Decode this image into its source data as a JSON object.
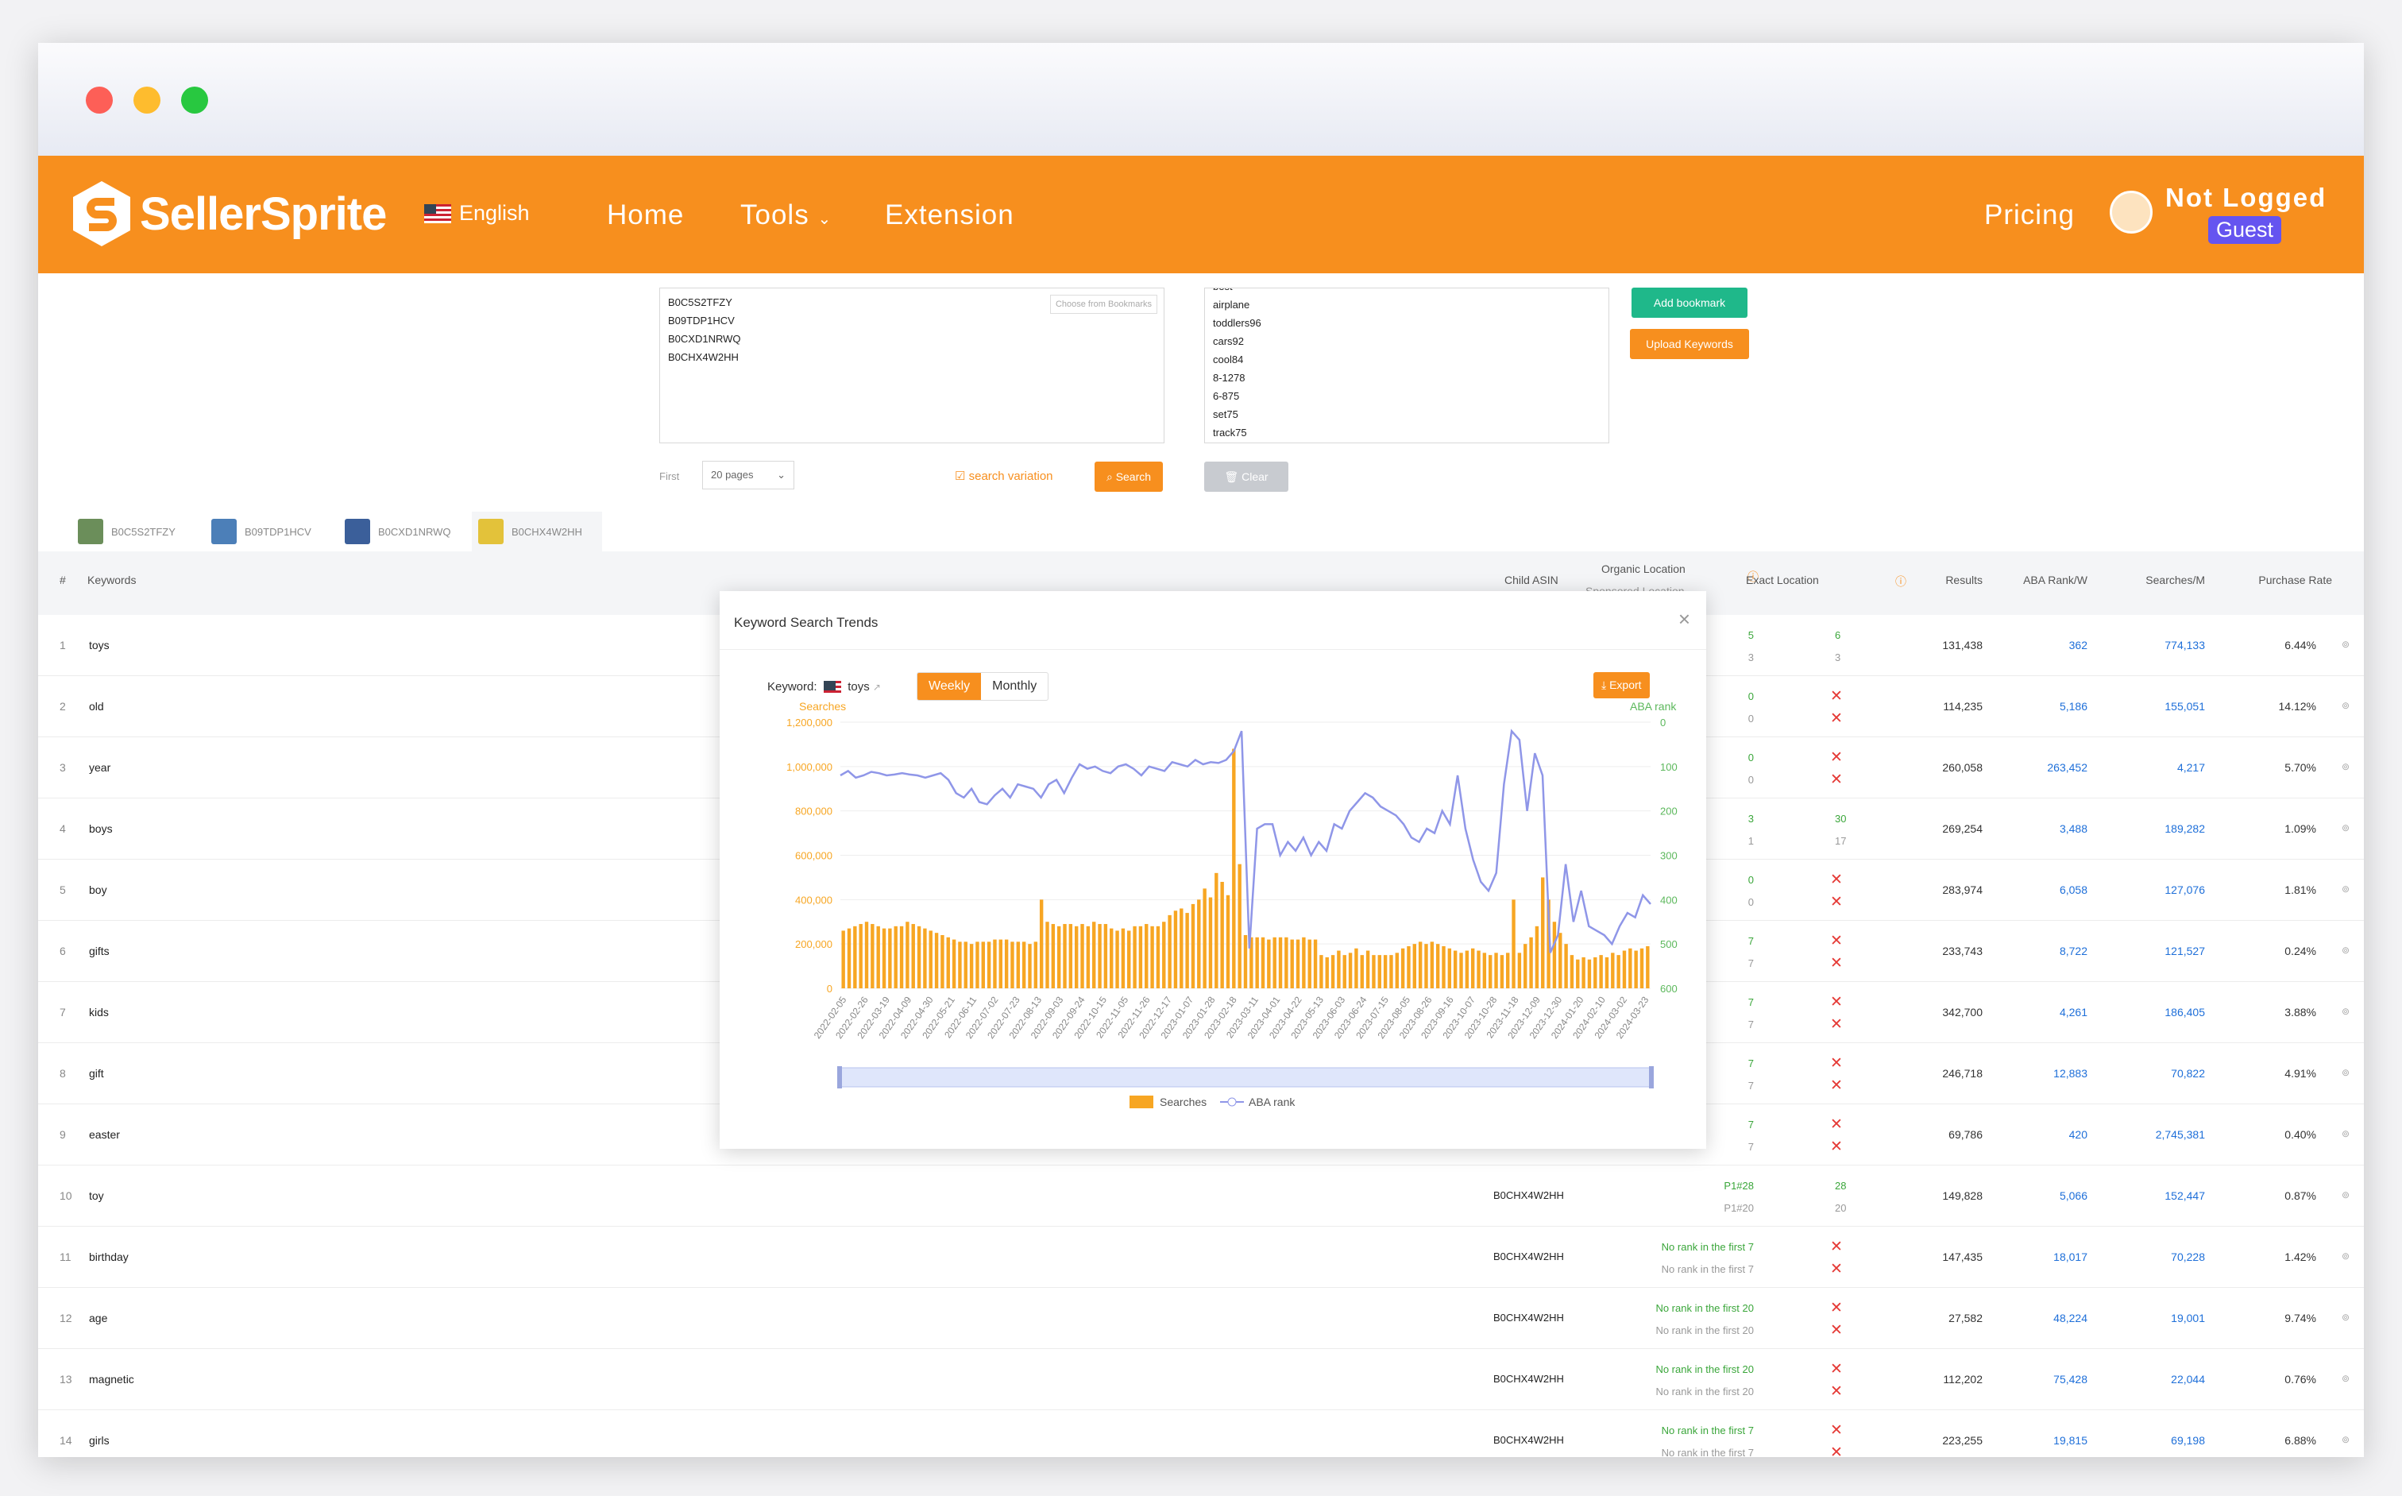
{
  "nav": {
    "logo": "SellerSprite",
    "lang": "English",
    "home": "Home",
    "tools": "Tools",
    "extension": "Extension",
    "pricing": "Pricing",
    "not_logged": "Not Logged",
    "guest": "Guest"
  },
  "form": {
    "asins": [
      "B0C5S2TFZY",
      "B09TDP1HCV",
      "B0CXD1NRWQ",
      "B0CHX4W2HH"
    ],
    "bookmark_placeholder": "Choose from Bookmarks",
    "keywords": [
      "best",
      "airplane",
      "toddlers96",
      "cars92",
      "cool84",
      "8-1278",
      "6-875",
      "set75",
      "track75"
    ],
    "add_bookmark": "Add bookmark",
    "upload_keywords": "Upload Keywords",
    "first_label": "First",
    "pages": "20 pages",
    "search_variation": "search variation",
    "search": "Search",
    "clear": "Clear"
  },
  "tabs": [
    "B0C5S2TFZY",
    "B09TDP1HCV",
    "B0CXD1NRWQ",
    "B0CHX4W2HH"
  ],
  "table": {
    "headers": {
      "num": "#",
      "keywords": "Keywords",
      "child_asin": "Child ASIN",
      "organic": "Organic Location",
      "sponsored": "Sponsored Location",
      "exact": "Exact Location",
      "results": "Results",
      "aba": "ABA Rank/W",
      "searches": "Searches/M",
      "purchase": "Purchase Rate"
    },
    "rows": [
      {
        "n": "1",
        "kw": "toys",
        "asin": "",
        "o1": "5",
        "o2": "3",
        "e1": "6",
        "e2": "3",
        "x": false,
        "res": "131,438",
        "aba": "362",
        "s": "774,133",
        "pr": "6.44%"
      },
      {
        "n": "2",
        "kw": "old",
        "asin": "",
        "o1": "0",
        "o2": "0",
        "e1": "",
        "e2": "",
        "x": true,
        "res": "114,235",
        "aba": "5,186",
        "s": "155,051",
        "pr": "14.12%"
      },
      {
        "n": "3",
        "kw": "year",
        "asin": "",
        "o1": "0",
        "o2": "0",
        "e1": "",
        "e2": "",
        "x": true,
        "res": "260,058",
        "aba": "263,452",
        "s": "4,217",
        "pr": "5.70%"
      },
      {
        "n": "4",
        "kw": "boys",
        "asin": "",
        "o1": "3",
        "o2": "1",
        "e1": "30",
        "e2": "17",
        "x": false,
        "res": "269,254",
        "aba": "3,488",
        "s": "189,282",
        "pr": "1.09%"
      },
      {
        "n": "5",
        "kw": "boy",
        "asin": "",
        "o1": "0",
        "o2": "0",
        "e1": "",
        "e2": "",
        "x": true,
        "res": "283,974",
        "aba": "6,058",
        "s": "127,076",
        "pr": "1.81%"
      },
      {
        "n": "6",
        "kw": "gifts",
        "asin": "",
        "o1": "7",
        "o2": "7",
        "e1": "",
        "e2": "",
        "x": true,
        "res": "233,743",
        "aba": "8,722",
        "s": "121,527",
        "pr": "0.24%"
      },
      {
        "n": "7",
        "kw": "kids",
        "asin": "",
        "o1": "7",
        "o2": "7",
        "e1": "",
        "e2": "",
        "x": true,
        "res": "342,700",
        "aba": "4,261",
        "s": "186,405",
        "pr": "3.88%"
      },
      {
        "n": "8",
        "kw": "gift",
        "asin": "",
        "o1": "7",
        "o2": "7",
        "e1": "",
        "e2": "",
        "x": true,
        "res": "246,718",
        "aba": "12,883",
        "s": "70,822",
        "pr": "4.91%"
      },
      {
        "n": "9",
        "kw": "easter",
        "asin": "",
        "o1": "7",
        "o2": "7",
        "e1": "",
        "e2": "",
        "x": true,
        "res": "69,786",
        "aba": "420",
        "s": "2,745,381",
        "pr": "0.40%"
      },
      {
        "n": "10",
        "kw": "toy",
        "asin": "B0CHX4W2HH",
        "o1": "P1#28",
        "o2": "P1#20",
        "e1": "28",
        "e2": "20",
        "x": false,
        "res": "149,828",
        "aba": "5,066",
        "s": "152,447",
        "pr": "0.87%"
      },
      {
        "n": "11",
        "kw": "birthday",
        "asin": "B0CHX4W2HH",
        "o1": "No rank in the first 7",
        "o2": "No rank in the first 7",
        "e1": "",
        "e2": "",
        "x": true,
        "res": "147,435",
        "aba": "18,017",
        "s": "70,228",
        "pr": "1.42%"
      },
      {
        "n": "12",
        "kw": "age",
        "asin": "B0CHX4W2HH",
        "o1": "No rank in the first 20",
        "o2": "No rank in the first 20",
        "e1": "",
        "e2": "",
        "x": true,
        "res": "27,582",
        "aba": "48,224",
        "s": "19,001",
        "pr": "9.74%"
      },
      {
        "n": "13",
        "kw": "magnetic",
        "asin": "B0CHX4W2HH",
        "o1": "No rank in the first 20",
        "o2": "No rank in the first 20",
        "e1": "",
        "e2": "",
        "x": true,
        "res": "112,202",
        "aba": "75,428",
        "s": "22,044",
        "pr": "0.76%"
      },
      {
        "n": "14",
        "kw": "girls",
        "asin": "B0CHX4W2HH",
        "o1": "No rank in the first 7",
        "o2": "No rank in the first 7",
        "e1": "",
        "e2": "",
        "x": true,
        "res": "223,255",
        "aba": "19,815",
        "s": "69,198",
        "pr": "6.88%"
      }
    ]
  },
  "modal": {
    "title": "Keyword Search Trends",
    "keyword_label": "Keyword:",
    "keyword": "toys",
    "weekly": "Weekly",
    "monthly": "Monthly",
    "export": "Export"
  },
  "chart_data": {
    "type": "bar",
    "title": "",
    "ylabel": "Searches",
    "y2label": "ABA rank",
    "ylim": [
      0,
      1200000
    ],
    "y2lim": [
      0,
      600
    ],
    "y2_inverted": true,
    "yticks": [
      "1,200,000",
      "1,000,000",
      "800,000",
      "600,000",
      "400,000",
      "200,000",
      "0"
    ],
    "y2ticks": [
      "0",
      "100",
      "200",
      "300",
      "400",
      "500",
      "600"
    ],
    "xticks": [
      "2022-02-05",
      "2022-02-26",
      "2022-03-19",
      "2022-04-09",
      "2022-04-30",
      "2022-05-21",
      "2022-06-11",
      "2022-07-02",
      "2022-07-23",
      "2022-08-13",
      "2022-09-03",
      "2022-09-24",
      "2022-10-15",
      "2022-11-05",
      "2022-11-26",
      "2022-12-17",
      "2023-01-07",
      "2023-01-28",
      "2023-02-18",
      "2023-03-11",
      "2023-04-01",
      "2023-04-22",
      "2023-05-13",
      "2023-06-03",
      "2023-06-24",
      "2023-07-15",
      "2023-08-05",
      "2023-08-26",
      "2023-09-16",
      "2023-10-07",
      "2023-10-28",
      "2023-11-18",
      "2023-12-09",
      "2023-12-30",
      "2024-01-20",
      "2024-02-10",
      "2024-03-02",
      "2024-03-23"
    ],
    "legend": [
      "Searches",
      "ABA rank"
    ],
    "series": [
      {
        "name": "Searches",
        "values": [
          260000,
          270000,
          280000,
          290000,
          300000,
          290000,
          280000,
          270000,
          270000,
          280000,
          280000,
          300000,
          290000,
          280000,
          270000,
          260000,
          250000,
          240000,
          230000,
          220000,
          210000,
          210000,
          200000,
          210000,
          210000,
          210000,
          220000,
          220000,
          220000,
          210000,
          210000,
          210000,
          200000,
          210000,
          400000,
          300000,
          290000,
          280000,
          290000,
          290000,
          280000,
          290000,
          280000,
          300000,
          290000,
          290000,
          270000,
          260000,
          270000,
          260000,
          280000,
          280000,
          290000,
          280000,
          280000,
          300000,
          330000,
          350000,
          360000,
          340000,
          380000,
          400000,
          450000,
          410000,
          520000,
          480000,
          420000,
          1080000,
          560000,
          240000,
          230000,
          230000,
          230000,
          220000,
          230000,
          230000,
          230000,
          220000,
          220000,
          230000,
          220000,
          220000,
          150000,
          140000,
          150000,
          170000,
          150000,
          160000,
          180000,
          150000,
          170000,
          150000,
          150000,
          150000,
          150000,
          160000,
          180000,
          190000,
          200000,
          210000,
          200000,
          210000,
          200000,
          190000,
          180000,
          170000,
          160000,
          170000,
          180000,
          170000,
          160000,
          150000,
          160000,
          150000,
          160000,
          400000,
          160000,
          200000,
          230000,
          280000,
          500000,
          400000,
          300000,
          250000,
          200000,
          150000,
          130000,
          140000,
          130000,
          140000,
          150000,
          140000,
          160000,
          150000,
          170000,
          180000,
          170000,
          180000,
          190000
        ]
      },
      {
        "name": "ABA rank",
        "values": [
          120,
          110,
          125,
          120,
          112,
          115,
          120,
          118,
          115,
          118,
          120,
          125,
          120,
          115,
          130,
          160,
          170,
          150,
          180,
          185,
          165,
          150,
          170,
          140,
          145,
          150,
          170,
          140,
          130,
          160,
          125,
          95,
          105,
          100,
          110,
          115,
          100,
          95,
          105,
          120,
          100,
          105,
          110,
          90,
          95,
          100,
          85,
          95,
          90,
          92,
          85,
          65,
          20,
          510,
          240,
          230,
          230,
          300,
          270,
          290,
          260,
          300,
          270,
          290,
          230,
          240,
          200,
          180,
          160,
          170,
          190,
          200,
          210,
          230,
          260,
          270,
          240,
          250,
          200,
          230,
          120,
          240,
          310,
          360,
          380,
          340,
          140,
          20,
          40,
          200,
          70,
          120,
          520,
          480,
          320,
          450,
          380,
          460,
          470,
          480,
          500,
          460,
          430,
          440,
          390,
          410
        ]
      }
    ]
  }
}
